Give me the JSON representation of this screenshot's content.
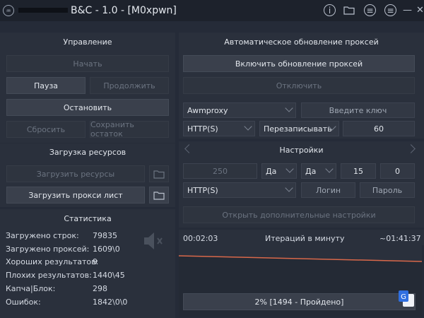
{
  "window": {
    "title": "B&C - 1.0 - [M0xpwn]",
    "icons": [
      "info-icon",
      "folder-icon",
      "list-icon",
      "menu-icon",
      "minimize-icon",
      "close-icon"
    ]
  },
  "control": {
    "header": "Управление",
    "start": "Начать",
    "pause": "Пауза",
    "resume": "Продолжить",
    "stop": "Остановить",
    "reset": "Сбросить",
    "save_rest": "Сохранить остаток"
  },
  "resources": {
    "header": "Загрузка ресурсов",
    "load_resources": "Загрузить ресурсы",
    "load_proxy": "Загрузить прокси лист"
  },
  "stats": {
    "header": "Статистика",
    "rows": [
      {
        "label": "Загружено строк:",
        "value": "79835"
      },
      {
        "label": "Загружено проксей:",
        "value": "1609\\0"
      },
      {
        "label": "Хороших результатов:",
        "value": "9"
      },
      {
        "label": "Плохих результатов:",
        "value": "1440\\45"
      },
      {
        "label": "Капча|Блок:",
        "value": "298"
      },
      {
        "label": "Ошибок:",
        "value": "1842\\0\\0"
      }
    ]
  },
  "proxy_update": {
    "header": "Автоматическое обновление проксей",
    "enable": "Включить обновление проксей",
    "disable": "Отключить",
    "source": "Awmproxy",
    "key_placeholder": "Введите ключ",
    "protocol": "HTTP(S)",
    "mode": "Перезаписывать",
    "interval": "60"
  },
  "settings": {
    "header": "Настройки",
    "threads": "250",
    "opt1": "Да",
    "opt2": "Да",
    "val1": "15",
    "val2": "0",
    "protocol": "HTTP(S)",
    "login": "Логин",
    "password": "Пароль",
    "advanced": "Открыть дополнительные настройки"
  },
  "status": {
    "elapsed": "00:02:03",
    "rate": "Итераций в минуту",
    "remaining": "~01:41:37",
    "progress_text": "2% [1494 - Пройдено]",
    "progress_percent": 2
  },
  "colors": {
    "chart_line": "#d9684a",
    "accent": "#2f6fe0"
  }
}
